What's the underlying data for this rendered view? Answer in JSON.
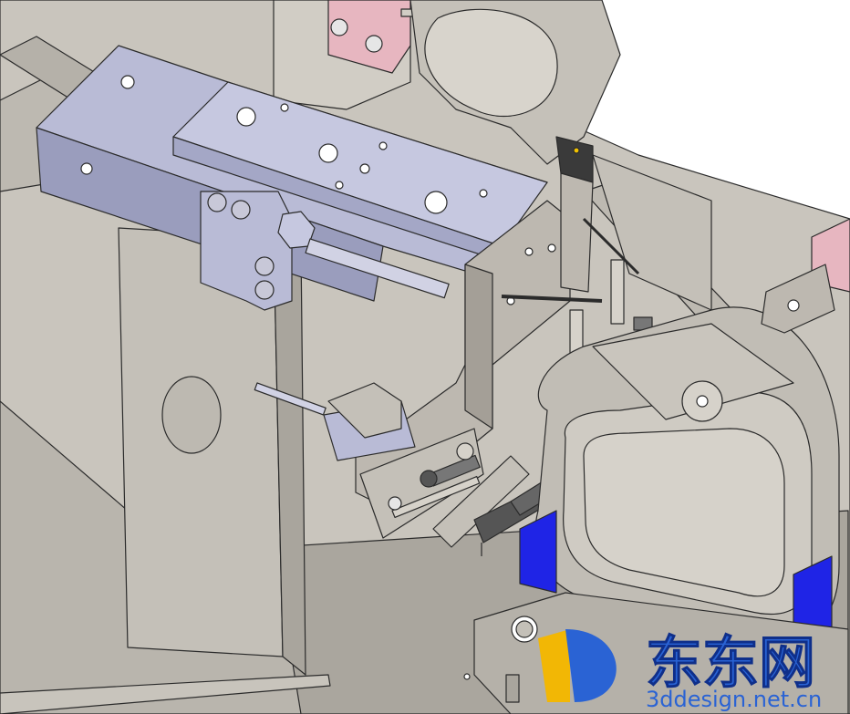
{
  "viewport": {
    "background": "#ffffff",
    "palette": {
      "frame": "#c9c5bd",
      "frame_dark": "#a9a59d",
      "edge": "#2b2b2b",
      "cylinder": "#b9bbd6",
      "cylinder_dark": "#9a9dbd",
      "bracket": "#bdb8b0",
      "clamp_blue": "#1f24e6",
      "pink": "#e7b6c0",
      "sensor": "#3a3a3a",
      "sensor_led": "#f2c200"
    }
  },
  "watermark": {
    "logo_letter": "D",
    "logo_gold": "#f2b705",
    "logo_blue": "#2a63d4",
    "title": "东东网",
    "domain": "3ddesign.net.cn"
  }
}
